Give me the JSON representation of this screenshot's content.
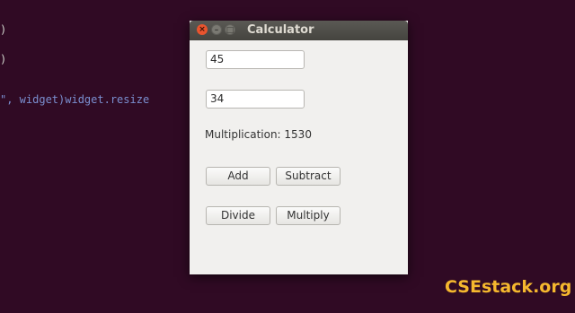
{
  "terminal": {
    "lines": [
      ")",
      ")",
      "\", widget)widget.resize"
    ]
  },
  "window": {
    "title": "Calculator",
    "close_glyph": "×",
    "min_glyph": "–",
    "max_glyph": "□"
  },
  "form": {
    "input_a": "45",
    "input_b": "34",
    "result": "Multiplication: 1530"
  },
  "buttons": {
    "add": "Add",
    "subtract": "Subtract",
    "divide": "Divide",
    "multiply": "Multiply"
  },
  "watermark": "CSEstack.org",
  "colors": {
    "desktop": "#300a24",
    "close_button": "#e9542e",
    "watermark": "#f5b82e"
  }
}
